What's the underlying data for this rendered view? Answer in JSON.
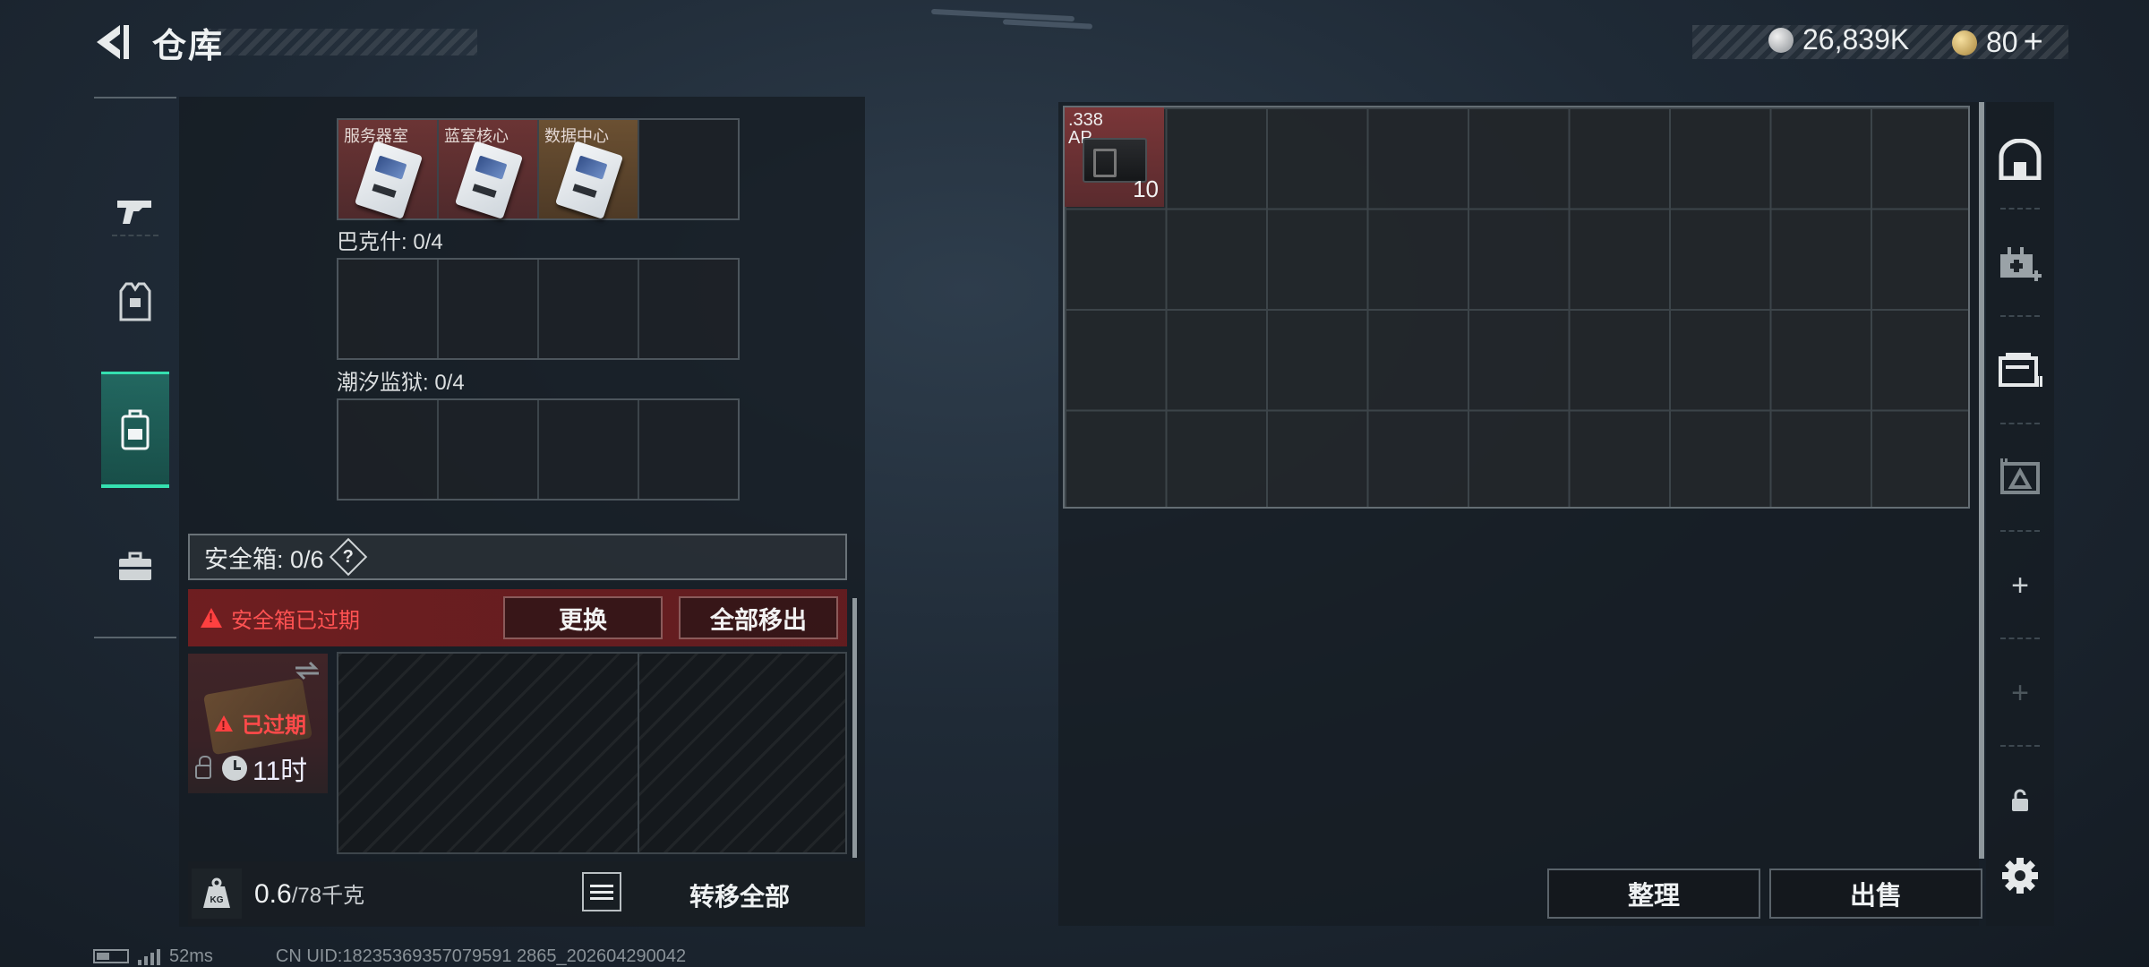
{
  "header": {
    "title": "仓库",
    "currency_primary": "26,839K",
    "currency_secondary": "80",
    "add_label": "+"
  },
  "left_nav": {
    "items": [
      {
        "name": "weapons",
        "icon": "pistol-icon"
      },
      {
        "name": "armor",
        "icon": "vest-icon"
      },
      {
        "name": "backpack",
        "icon": "backpack-icon",
        "active": true
      },
      {
        "name": "containers",
        "icon": "briefcase-icon"
      }
    ]
  },
  "key_sections": [
    {
      "label": "",
      "slots": [
        {
          "label": "服务器室",
          "color": "red"
        },
        {
          "label": "蓝室核心",
          "color": "red"
        },
        {
          "label": "数据中心",
          "color": "gold"
        },
        {
          "label": "",
          "color": "empty"
        }
      ]
    },
    {
      "label": "巴克什: 0/4",
      "slots": []
    },
    {
      "label": "潮汐监狱: 0/4",
      "slots": []
    }
  ],
  "safebox": {
    "header": "安全箱: 0/6",
    "help": "?",
    "expired_warning": "安全箱已过期",
    "replace_label": "更换",
    "move_all_label": "全部移出",
    "thumb_expired": "已过期",
    "timer": "11时"
  },
  "footer": {
    "weight_value": "0.6",
    "weight_max": "/78千克",
    "transfer_all": "转移全部"
  },
  "stash": {
    "items": [
      {
        "name": ".338\nAP",
        "count": "10"
      }
    ],
    "sort_label": "整理",
    "sell_label": "出售"
  },
  "right_tools": [
    {
      "name": "stash-tab-main",
      "icon": "vault-icon"
    },
    {
      "name": "stash-tab-medical",
      "icon": "medkit-add-icon"
    },
    {
      "name": "stash-tab-storage",
      "icon": "storage-box-icon"
    },
    {
      "name": "stash-tab-collection",
      "icon": "collection-icon"
    },
    {
      "name": "add-stash-tab",
      "icon": "plus-icon"
    },
    {
      "name": "add-stash-tab-disabled",
      "icon": "plus-icon"
    },
    {
      "name": "lock-toggle",
      "icon": "lock-icon"
    },
    {
      "name": "settings",
      "icon": "gear-icon"
    }
  ],
  "status": {
    "ping": "52ms",
    "uid": "CN UID:18235369357079591 2865_202604290042"
  },
  "colors": {
    "accent_teal": "#35e0b0",
    "warning_red": "#ff4a4a",
    "item_red": "#6b3434",
    "item_gold": "#6b5032"
  }
}
